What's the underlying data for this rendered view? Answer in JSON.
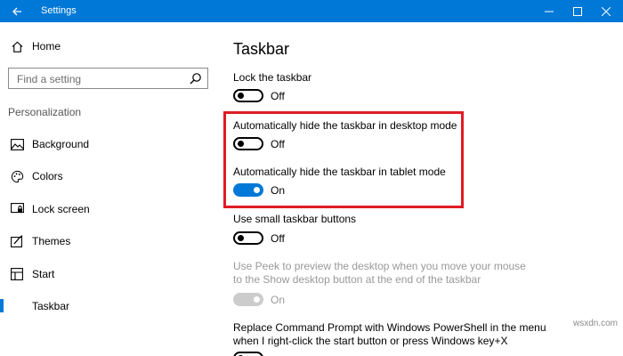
{
  "window": {
    "title": "Settings"
  },
  "sidebar": {
    "home_label": "Home",
    "search_placeholder": "Find a setting",
    "section_label": "Personalization",
    "items": [
      {
        "label": "Background",
        "icon": "image-icon"
      },
      {
        "label": "Colors",
        "icon": "palette-icon"
      },
      {
        "label": "Lock screen",
        "icon": "lock-screen-icon"
      },
      {
        "label": "Themes",
        "icon": "themes-icon"
      },
      {
        "label": "Start",
        "icon": "start-icon"
      },
      {
        "label": "Taskbar",
        "icon": "taskbar-icon",
        "active": true
      }
    ]
  },
  "main": {
    "title": "Taskbar",
    "settings": [
      {
        "label": "Lock the taskbar",
        "state": "Off"
      },
      {
        "label": "Automatically hide the taskbar in desktop mode",
        "state": "Off"
      },
      {
        "label": "Automatically hide the taskbar in tablet mode",
        "state": "On"
      },
      {
        "label": "Use small taskbar buttons",
        "state": "Off"
      },
      {
        "label": "Use Peek to preview the desktop when you move your mouse to the Show desktop button at the end of the taskbar",
        "state": "On",
        "disabled": true
      },
      {
        "label": "Replace Command Prompt with Windows PowerShell in the menu when I right-click the start button or press Windows key+X"
      }
    ]
  },
  "colors": {
    "accent": "#0078d7",
    "highlight": "#e01b24"
  },
  "watermark": "wsxdn.com"
}
